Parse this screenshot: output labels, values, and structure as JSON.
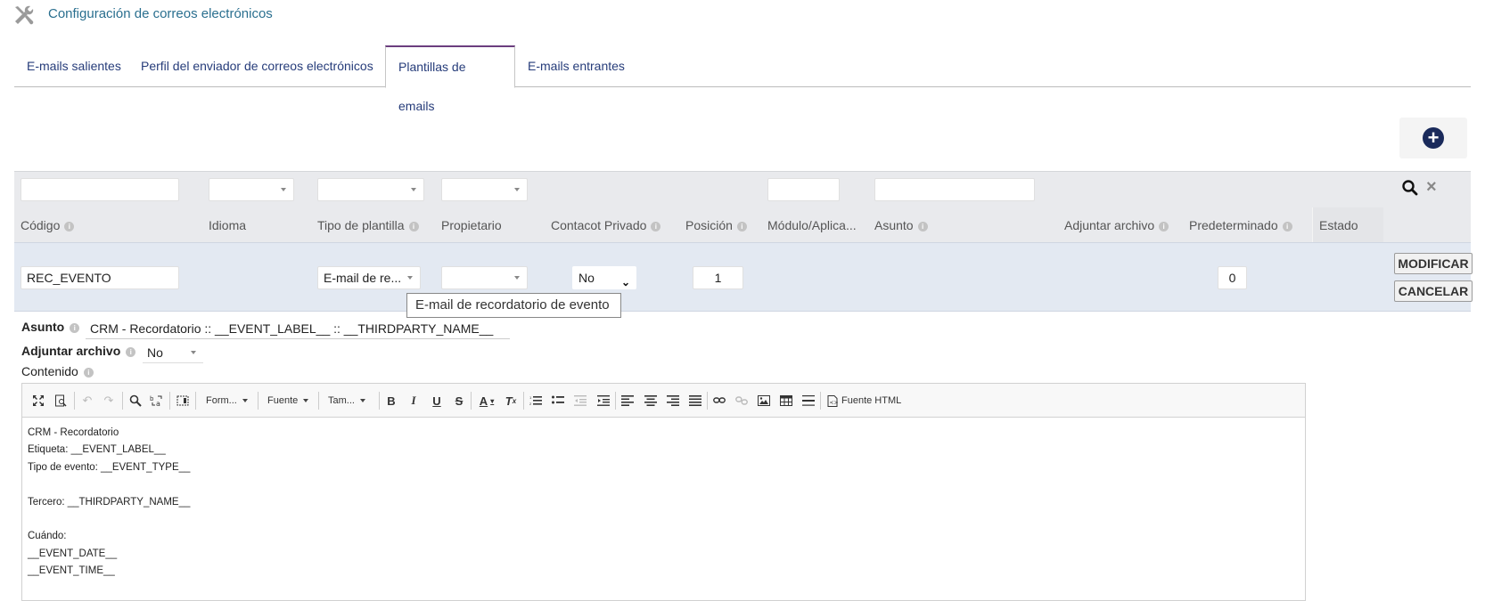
{
  "page": {
    "title": "Configuración de correos electrónicos",
    "icon": "tools-icon"
  },
  "tabs": [
    {
      "label": "E-mails salientes",
      "active": false
    },
    {
      "label": "Perfil del enviador de correos electrónicos",
      "active": false
    },
    {
      "label": "Plantillas de emails",
      "active": true
    },
    {
      "label": "E-mails entrantes",
      "active": false
    }
  ],
  "columns": {
    "codigo": "Código",
    "idioma": "Idioma",
    "tipo": "Tipo de plantilla",
    "propietario": "Propietario",
    "privado": "Contacot Privado",
    "posicion": "Posición",
    "modulo": "Módulo/Aplica...",
    "asunto": "Asunto",
    "adjuntar": "Adjuntar archivo",
    "predeterminado": "Predeterminado",
    "estado": "Estado"
  },
  "edit_row": {
    "codigo": "REC_EVENTO",
    "tipo": "E-mail de re...",
    "privado": "No",
    "posicion": "1",
    "predeterminado": "0",
    "modify_label": "MODIFICAR",
    "cancel_label": "CANCELAR"
  },
  "tooltip": "E-mail de recordatorio de evento",
  "form": {
    "asunto_label": "Asunto",
    "asunto_value": "CRM - Recordatorio :: __EVENT_LABEL__ :: __THIRDPARTY_NAME__",
    "adjuntar_label": "Adjuntar archivo",
    "adjuntar_value": "No",
    "contenido_label": "Contenido"
  },
  "toolbar": {
    "format": "Form...",
    "font": "Fuente",
    "size": "Tam...",
    "source": "Fuente HTML"
  },
  "content_lines": [
    "CRM - Recordatorio",
    "Etiqueta: __EVENT_LABEL__",
    "Tipo de evento: __EVENT_TYPE__",
    "",
    "Tercero: __THIRDPARTY_NAME__",
    "",
    "Cuándo:",
    "__EVENT_DATE__",
    "__EVENT_TIME__"
  ],
  "colors": {
    "title": "#2a6f8f",
    "tab_text": "#263c7a",
    "tab_active_border": "#6b3e7e",
    "filter_bg": "#e9eaed",
    "edit_row_bg": "#e3e9f2",
    "add_button": "#1a2a5b"
  }
}
